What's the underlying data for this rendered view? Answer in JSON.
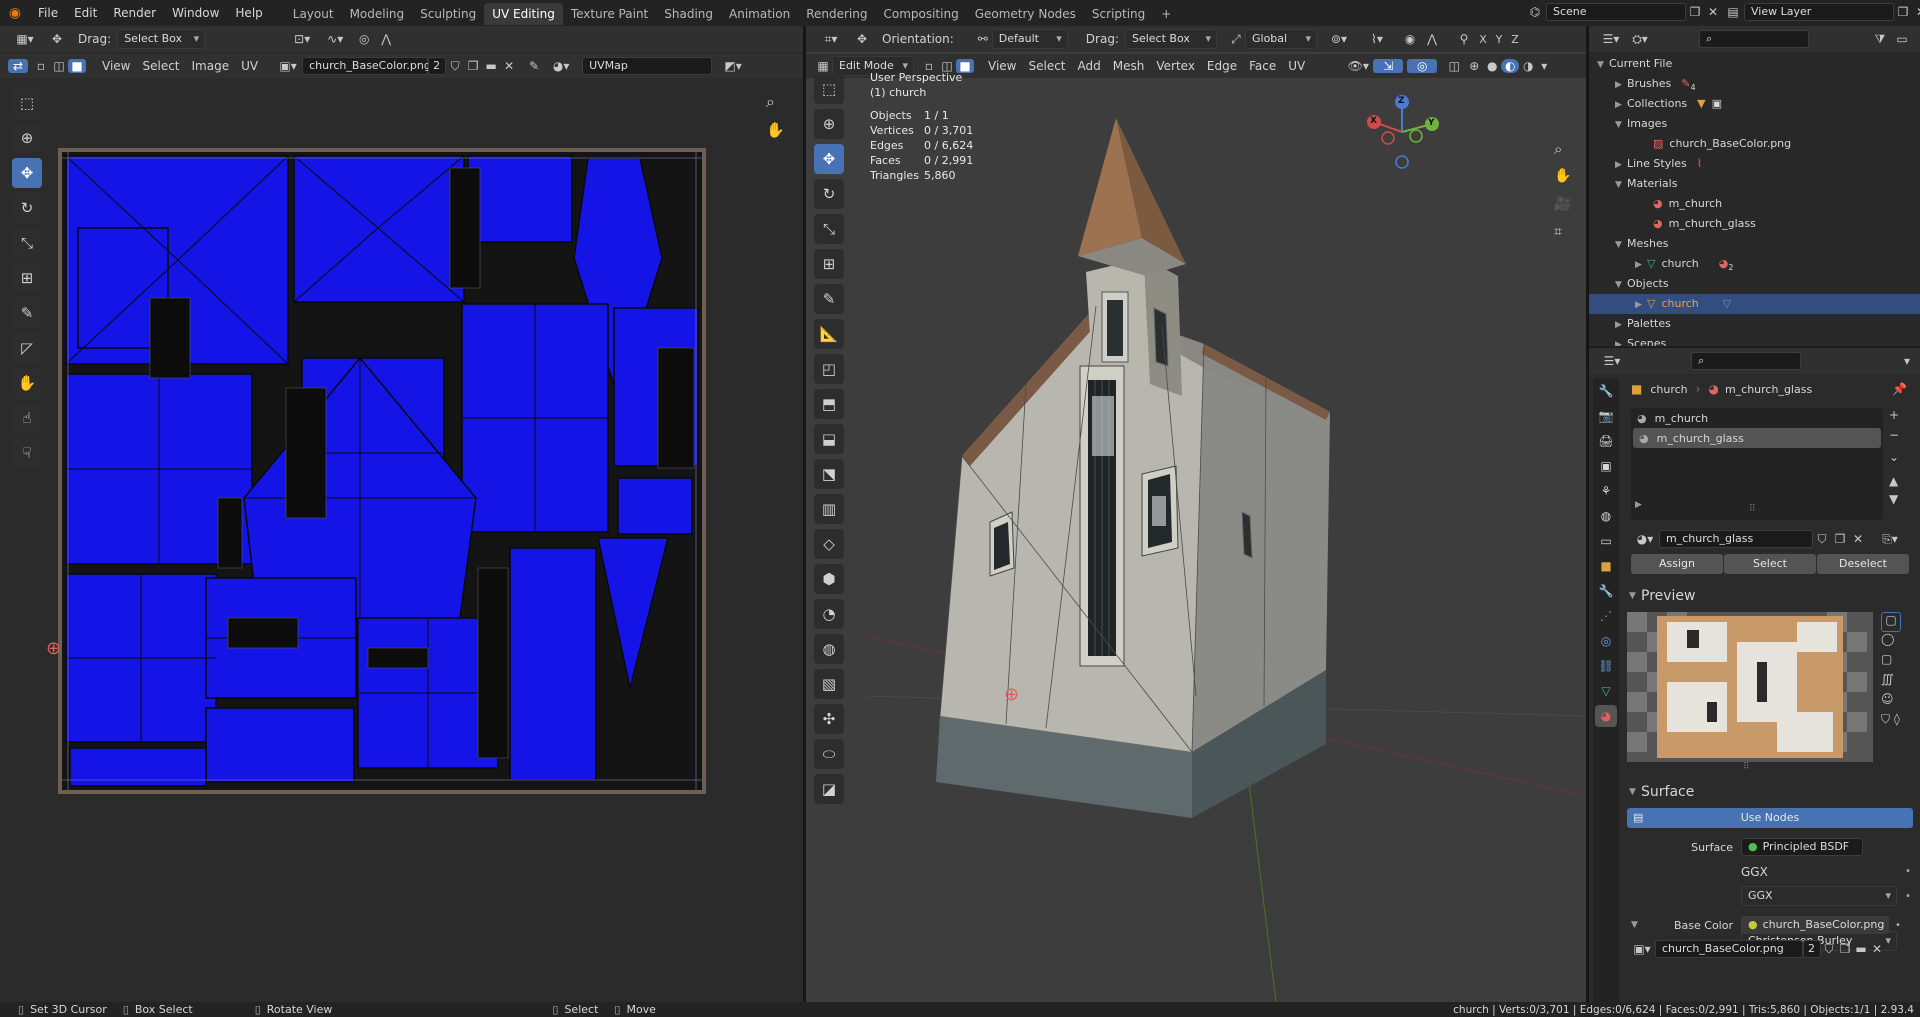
{
  "topbar": {
    "menus": [
      "File",
      "Edit",
      "Render",
      "Window",
      "Help"
    ],
    "workspaces": [
      "Layout",
      "Modeling",
      "Sculpting",
      "UV Editing",
      "Texture Paint",
      "Shading",
      "Animation",
      "Rendering",
      "Compositing",
      "Geometry Nodes",
      "Scripting"
    ],
    "active_workspace": "UV Editing",
    "add_workspace": "+",
    "scene": "Scene",
    "view_layer": "View Layer"
  },
  "uv_editor": {
    "drag_label": "Drag:",
    "drag_value": "Select Box",
    "menus": [
      "View",
      "Select",
      "Image",
      "UV"
    ],
    "image_name": "church_BaseColor.png",
    "image_users": "2",
    "uvmap": "UVMap"
  },
  "viewport": {
    "orientation_label": "Orientation:",
    "orientation_value": "Default",
    "drag_label": "Drag:",
    "drag_value": "Select Box",
    "transform_space": "Global",
    "mode": "Edit Mode",
    "menus": [
      "View",
      "Select",
      "Add",
      "Mesh",
      "Vertex",
      "Edge",
      "Face",
      "UV"
    ],
    "axis_toggles": [
      "X",
      "Y",
      "Z"
    ],
    "overlay_title": "User Perspective",
    "overlay_object": "(1) church",
    "stats": [
      {
        "label": "Objects",
        "value": "1 / 1"
      },
      {
        "label": "Vertices",
        "value": "0 / 3,701"
      },
      {
        "label": "Edges",
        "value": "0 / 6,624"
      },
      {
        "label": "Faces",
        "value": "0 / 2,991"
      },
      {
        "label": "Triangles",
        "value": "5,860"
      }
    ],
    "gizmo": {
      "x": "X",
      "y": "Y",
      "z": "Z"
    }
  },
  "outliner": {
    "rows": [
      {
        "label": "Current File",
        "depth": 0,
        "expanded": true
      },
      {
        "label": "Brushes",
        "depth": 1,
        "expanded": false,
        "badge": "4"
      },
      {
        "label": "Collections",
        "depth": 1,
        "expanded": false
      },
      {
        "label": "Images",
        "depth": 1,
        "expanded": true
      },
      {
        "label": "church_BaseColor.png",
        "depth": 2
      },
      {
        "label": "Line Styles",
        "depth": 1,
        "expanded": false
      },
      {
        "label": "Materials",
        "depth": 1,
        "expanded": true
      },
      {
        "label": "m_church",
        "depth": 2
      },
      {
        "label": "m_church_glass",
        "depth": 2
      },
      {
        "label": "Meshes",
        "depth": 1,
        "expanded": true
      },
      {
        "label": "church",
        "depth": 2,
        "badge": "2"
      },
      {
        "label": "Objects",
        "depth": 1,
        "expanded": true
      },
      {
        "label": "church",
        "depth": 2,
        "selected": true
      },
      {
        "label": "Palettes",
        "depth": 1,
        "expanded": false
      },
      {
        "label": "Scenes",
        "depth": 1,
        "expanded": false
      }
    ]
  },
  "properties": {
    "breadcrumb_object": "church",
    "breadcrumb_material": "m_church_glass",
    "slots": [
      "m_church",
      "m_church_glass"
    ],
    "active_slot": "m_church_glass",
    "material_name": "m_church_glass",
    "assign": "Assign",
    "select": "Select",
    "deselect": "Deselect",
    "preview_header": "Preview",
    "surface_header": "Surface",
    "use_nodes": "Use Nodes",
    "surface_label": "Surface",
    "surface_value": "Principled BSDF",
    "distribution": "GGX",
    "subsurface": "Christensen-Burley",
    "base_color_label": "Base Color",
    "base_color_value": "church_BaseColor.png",
    "image_name": "church_BaseColor.png",
    "image_users": "2"
  },
  "statusbar": {
    "hints": [
      "Set 3D Cursor",
      "Box Select",
      "Rotate View",
      "Select",
      "Move"
    ],
    "stats": "church | Verts:0/3,701 | Edges:0/6,624 | Faces:0/2,991 | Tris:5,860 | Objects:1/1 | 2.93.4"
  },
  "colors": {
    "accent": "#4772b3",
    "uv_face": "#1414e6",
    "selected_row": "#334d80"
  }
}
